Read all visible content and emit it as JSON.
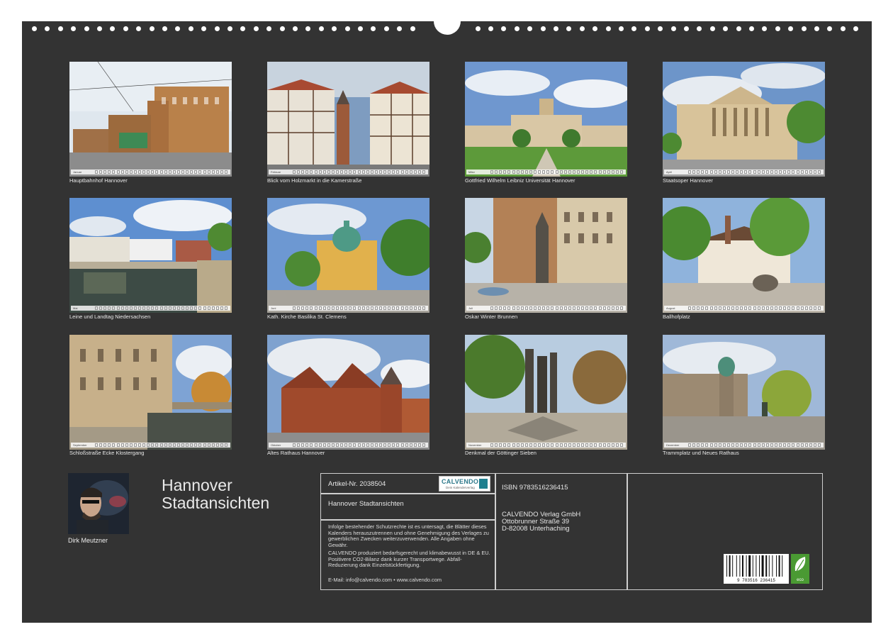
{
  "months": [
    {
      "label": "Hauptbahnhof Hannover",
      "month": "Januar"
    },
    {
      "label": "Blick vom Holzmarkt in die Kamerstraße",
      "month": "Februar"
    },
    {
      "label": "Gottfried Wilhelm Leibniz Universität Hannover",
      "month": "März"
    },
    {
      "label": "Staatsoper Hannover",
      "month": "April"
    },
    {
      "label": "Leine und Landtag Niedersachsen",
      "month": "Mai"
    },
    {
      "label": "Kath. Kirche Basilika St. Clemens",
      "month": "Juni"
    },
    {
      "label": "Oskar Winter Brunnen",
      "month": "Juli"
    },
    {
      "label": "Ballhofplatz",
      "month": "August"
    },
    {
      "label": "Schloßstraße Ecke Klostergang",
      "month": "September"
    },
    {
      "label": "Altes Rathaus Hannover",
      "month": "Oktober"
    },
    {
      "label": "Denkmal der Göttinger Sieben",
      "month": "November"
    },
    {
      "label": "Trammplatz und Neues Rathaus",
      "month": "Dezember"
    }
  ],
  "author": {
    "name": "Dirk Meutzner"
  },
  "calendar_title": {
    "line1": "Hannover",
    "line2": "Stadtansichten"
  },
  "info": {
    "article": "Artikel-Nr. 2038504",
    "subtitle": "Hannover Stadtansichten",
    "isbn": "ISBN 9783516236415",
    "publisher": [
      "CALVENDO Verlag GmbH",
      "Ottobrunner Straße 39",
      "D-82008 Unterhaching"
    ],
    "legal": "Infolge bestehender Schutzrechte ist es untersagt, die Blätter dieses Kalenders herauszutrennen und ohne Genehmigung des Verlages zu gewerblichen Zwecken weiterzuverwenden. Alle Angaben ohne Gewähr.",
    "eco_text": "CALVENDO produziert bedarfsgerecht und klimabewusst in DE & EU. Positivere CO2-Bilanz dank kurzer Transportwege. Abfall-Reduzierung dank Einzelstückfertigung.",
    "contact": "E-Mail: info@calvendo.com • www.calvendo.com",
    "logo_brand": "CALVENDO",
    "logo_sub": "Dein Kalenderverlag",
    "barcode_number": "9 783516 236415",
    "eco_label": "eco"
  }
}
